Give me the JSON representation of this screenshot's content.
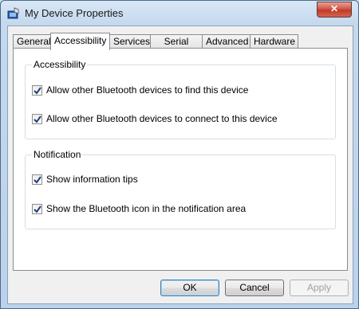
{
  "window": {
    "title": "My Device Properties",
    "close_label": "✕"
  },
  "tabs": [
    {
      "label": "General"
    },
    {
      "label": "Accessibility"
    },
    {
      "label": "Services"
    },
    {
      "label": "Serial Ports"
    },
    {
      "label": "Advanced"
    },
    {
      "label": "Hardware"
    }
  ],
  "active_tab": "Accessibility",
  "groups": {
    "accessibility": {
      "title": "Accessibility",
      "options": [
        {
          "label": "Allow other Bluetooth devices to find this device",
          "checked": true
        },
        {
          "label": "Allow other Bluetooth devices to connect to this device",
          "checked": true
        }
      ]
    },
    "notification": {
      "title": "Notification",
      "options": [
        {
          "label": "Show information tips",
          "checked": true
        },
        {
          "label": "Show the Bluetooth icon in the notification area",
          "checked": true
        }
      ]
    }
  },
  "buttons": {
    "ok": "OK",
    "cancel": "Cancel",
    "apply": "Apply"
  },
  "colors": {
    "title_bar": "#c4d8ee",
    "close": "#c0392b",
    "check": "#1e3f7a"
  }
}
